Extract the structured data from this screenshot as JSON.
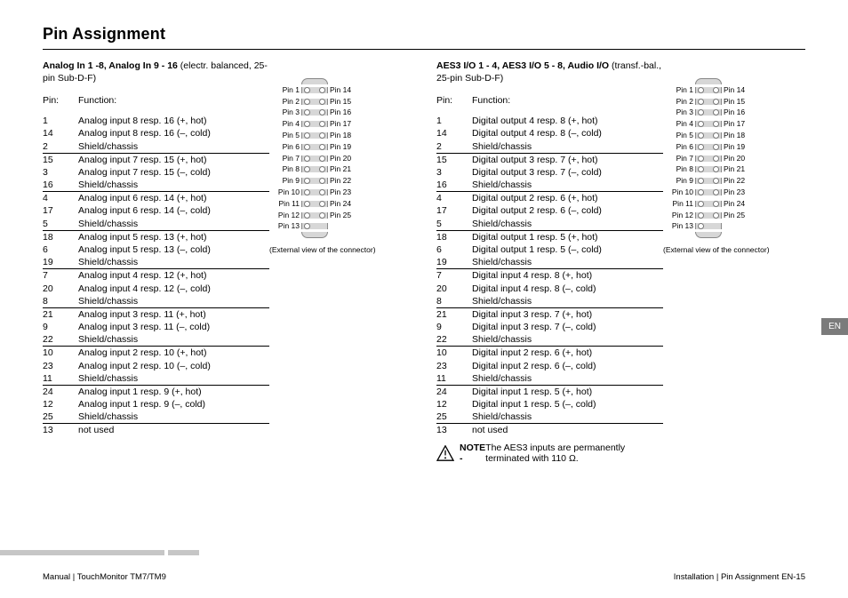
{
  "title": "Pin Assignment",
  "langTab": "EN",
  "footer": {
    "left": "Manual | TouchMonitor TM7/TM9",
    "right": "Installation | Pin Assignment    EN-15"
  },
  "tables": [
    {
      "heading_bold": "Analog In 1 -8, Analog In 9 - 16",
      "heading_rest": " (electr. balanced, 25-pin Sub-D-F)",
      "pin_hdr": "Pin:",
      "func_hdr": "Function:",
      "groups": [
        [
          {
            "pin": "1",
            "func": "Analog input 8 resp. 16 (+, hot)"
          },
          {
            "pin": "14",
            "func": "Analog input 8 resp. 16 (–, cold)"
          },
          {
            "pin": "2",
            "func": "Shield/chassis"
          }
        ],
        [
          {
            "pin": "15",
            "func": "Analog input 7 resp. 15 (+, hot)"
          },
          {
            "pin": "3",
            "func": "Analog input 7 resp. 15 (–, cold)"
          },
          {
            "pin": "16",
            "func": "Shield/chassis"
          }
        ],
        [
          {
            "pin": "4",
            "func": "Analog input 6 resp. 14 (+, hot)"
          },
          {
            "pin": "17",
            "func": "Analog input 6 resp. 14 (–, cold)"
          },
          {
            "pin": "5",
            "func": "Shield/chassis"
          }
        ],
        [
          {
            "pin": "18",
            "func": "Analog input 5 resp. 13 (+, hot)"
          },
          {
            "pin": "6",
            "func": "Analog input 5 resp. 13 (–, cold)"
          },
          {
            "pin": "19",
            "func": "Shield/chassis"
          }
        ],
        [
          {
            "pin": "7",
            "func": "Analog input 4 resp. 12 (+, hot)"
          },
          {
            "pin": "20",
            "func": "Analog input 4 resp. 12 (–, cold)"
          },
          {
            "pin": "8",
            "func": "Shield/chassis"
          }
        ],
        [
          {
            "pin": "21",
            "func": "Analog input 3 resp. 11 (+, hot)"
          },
          {
            "pin": "9",
            "func": "Analog input 3 resp. 11 (–, cold)"
          },
          {
            "pin": "22",
            "func": "Shield/chassis"
          }
        ],
        [
          {
            "pin": "10",
            "func": "Analog input 2 resp. 10 (+, hot)"
          },
          {
            "pin": "23",
            "func": "Analog input 2 resp. 10 (–, cold)"
          },
          {
            "pin": "11",
            "func": "Shield/chassis"
          }
        ],
        [
          {
            "pin": "24",
            "func": "Analog input 1 resp. 9 (+, hot)"
          },
          {
            "pin": "12",
            "func": "Analog input 1 resp. 9 (–, cold)"
          },
          {
            "pin": "25",
            "func": "Shield/chassis"
          }
        ]
      ],
      "tail": {
        "pin": "13",
        "func": "not used"
      },
      "connector": {
        "left": [
          "Pin 1",
          "Pin 2",
          "Pin 3",
          "Pin 4",
          "Pin 5",
          "Pin 6",
          "Pin 7",
          "Pin 8",
          "Pin 9",
          "Pin 10",
          "Pin 11",
          "Pin 12",
          "Pin 13"
        ],
        "right": [
          "Pin 14",
          "Pin 15",
          "Pin 16",
          "Pin 17",
          "Pin 18",
          "Pin 19",
          "Pin 20",
          "Pin 21",
          "Pin 22",
          "Pin 23",
          "Pin 24",
          "Pin 25"
        ],
        "caption": "(External view of the connector)"
      }
    },
    {
      "heading_bold": "AES3 I/O 1 - 4, AES3 I/O 5 - 8, Audio I/O",
      "heading_rest": " (transf.-bal., 25-pin Sub-D-F)",
      "pin_hdr": "Pin:",
      "func_hdr": "Function:",
      "groups": [
        [
          {
            "pin": "1",
            "func": "Digital output 4 resp. 8 (+, hot)"
          },
          {
            "pin": "14",
            "func": "Digital output 4 resp. 8 (–, cold)"
          },
          {
            "pin": "2",
            "func": "Shield/chassis"
          }
        ],
        [
          {
            "pin": "15",
            "func": "Digital output 3 resp. 7 (+, hot)"
          },
          {
            "pin": "3",
            "func": "Digital output 3 resp. 7 (–, cold)"
          },
          {
            "pin": "16",
            "func": "Shield/chassis"
          }
        ],
        [
          {
            "pin": "4",
            "func": "Digital output 2 resp. 6 (+, hot)"
          },
          {
            "pin": "17",
            "func": "Digital output 2 resp. 6 (–, cold)"
          },
          {
            "pin": "5",
            "func": "Shield/chassis"
          }
        ],
        [
          {
            "pin": "18",
            "func": "Digital output 1 resp. 5 (+, hot)"
          },
          {
            "pin": "6",
            "func": "Digital output 1 resp. 5 (–, cold)"
          },
          {
            "pin": "19",
            "func": "Shield/chassis"
          }
        ],
        [
          {
            "pin": "7",
            "func": "Digital input 4 resp. 8 (+, hot)"
          },
          {
            "pin": "20",
            "func": "Digital input 4 resp. 8 (–, cold)"
          },
          {
            "pin": "8",
            "func": "Shield/chassis"
          }
        ],
        [
          {
            "pin": "21",
            "func": "Digital input 3 resp. 7 (+, hot)"
          },
          {
            "pin": "9",
            "func": "Digital input 3 resp. 7 (–, cold)"
          },
          {
            "pin": "22",
            "func": "Shield/chassis"
          }
        ],
        [
          {
            "pin": "10",
            "func": "Digital input 2 resp. 6 (+, hot)"
          },
          {
            "pin": "23",
            "func": "Digital input 2 resp. 6 (–, cold)"
          },
          {
            "pin": "11",
            "func": "Shield/chassis"
          }
        ],
        [
          {
            "pin": "24",
            "func": "Digital input 1 resp. 5 (+, hot)"
          },
          {
            "pin": "12",
            "func": "Digital input 1 resp. 5 (–, cold)"
          },
          {
            "pin": "25",
            "func": "Shield/chassis"
          }
        ]
      ],
      "tail": {
        "pin": "13",
        "func": "not used"
      },
      "connector": {
        "left": [
          "Pin 1",
          "Pin 2",
          "Pin 3",
          "Pin 4",
          "Pin 5",
          "Pin 6",
          "Pin 7",
          "Pin 8",
          "Pin 9",
          "Pin 10",
          "Pin 11",
          "Pin 12",
          "Pin 13"
        ],
        "right": [
          "Pin 14",
          "Pin 15",
          "Pin 16",
          "Pin 17",
          "Pin 18",
          "Pin 19",
          "Pin 20",
          "Pin 21",
          "Pin 22",
          "Pin 23",
          "Pin 24",
          "Pin 25"
        ],
        "caption": "(External view of the connector)"
      },
      "note_label": "NOTE -",
      "note_text": " The AES3 inputs are permanently terminated with 110 Ω."
    }
  ]
}
